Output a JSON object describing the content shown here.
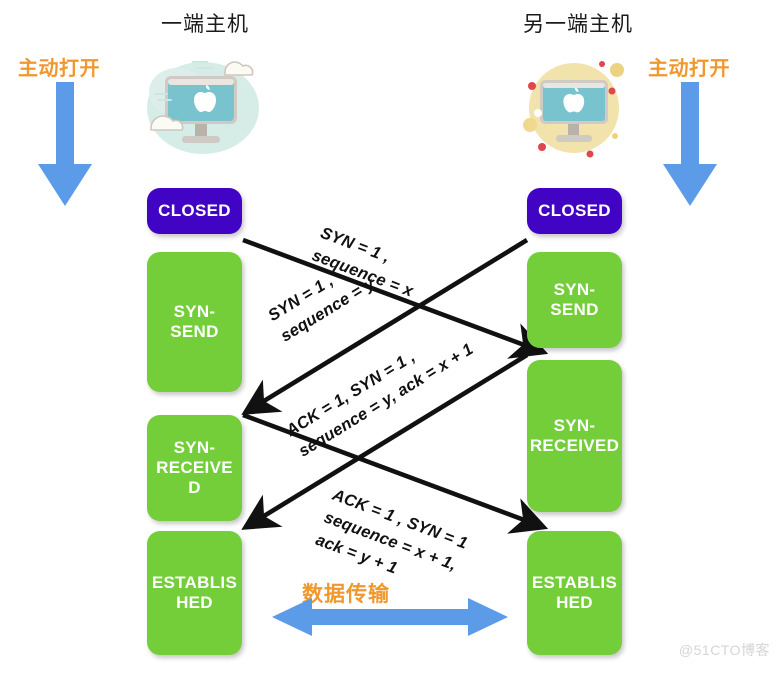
{
  "diagram": {
    "title_left": "一端主机",
    "title_right": "另一端主机",
    "side_label_left": "主动打开",
    "side_label_right": "主动打开",
    "data_transfer": "数据传输",
    "watermark": "@51CTO博客",
    "colors": {
      "closed_box": "#4104c4",
      "state_box": "#73ce3a",
      "accent_orange": "#f0982d",
      "arrow_blue": "#5b9be8",
      "line_black": "#111111",
      "background": "#ffffff"
    },
    "left_states": [
      {
        "label": "CLOSED",
        "kind": "closed"
      },
      {
        "label": "SYN-\nSEND",
        "kind": "green"
      },
      {
        "label": "SYN-\nRECEIVE\nD",
        "kind": "green"
      },
      {
        "label": "ESTABLIS\nHED",
        "kind": "green"
      }
    ],
    "right_states": [
      {
        "label": "CLOSED",
        "kind": "closed"
      },
      {
        "label": "SYN-\nSEND",
        "kind": "green"
      },
      {
        "label": "SYN-\nRECEIVED",
        "kind": "green"
      },
      {
        "label": "ESTABLIS\nHED",
        "kind": "green"
      }
    ],
    "messages": [
      {
        "line1": "SYN = 1 ,",
        "line2": "sequence = x",
        "direction": "left-to-right"
      },
      {
        "line1": "SYN = 1 ,",
        "line2": "sequence = y",
        "direction": "right-to-left"
      },
      {
        "line1": "ACK = 1, SYN = 1 ,",
        "line2": "sequence = y, ack = x + 1",
        "direction": "right-to-left"
      },
      {
        "line1": "ACK = 1 , SYN = 1",
        "line2": "sequence = x + 1,",
        "line3": "ack = y + 1",
        "direction": "left-to-right"
      }
    ],
    "icons": {
      "left_host": "imac-cloud-icon",
      "right_host": "imac-circle-icon",
      "down_arrow": "down-arrow-icon",
      "transfer_arrow": "double-headed-arrow-icon"
    }
  }
}
